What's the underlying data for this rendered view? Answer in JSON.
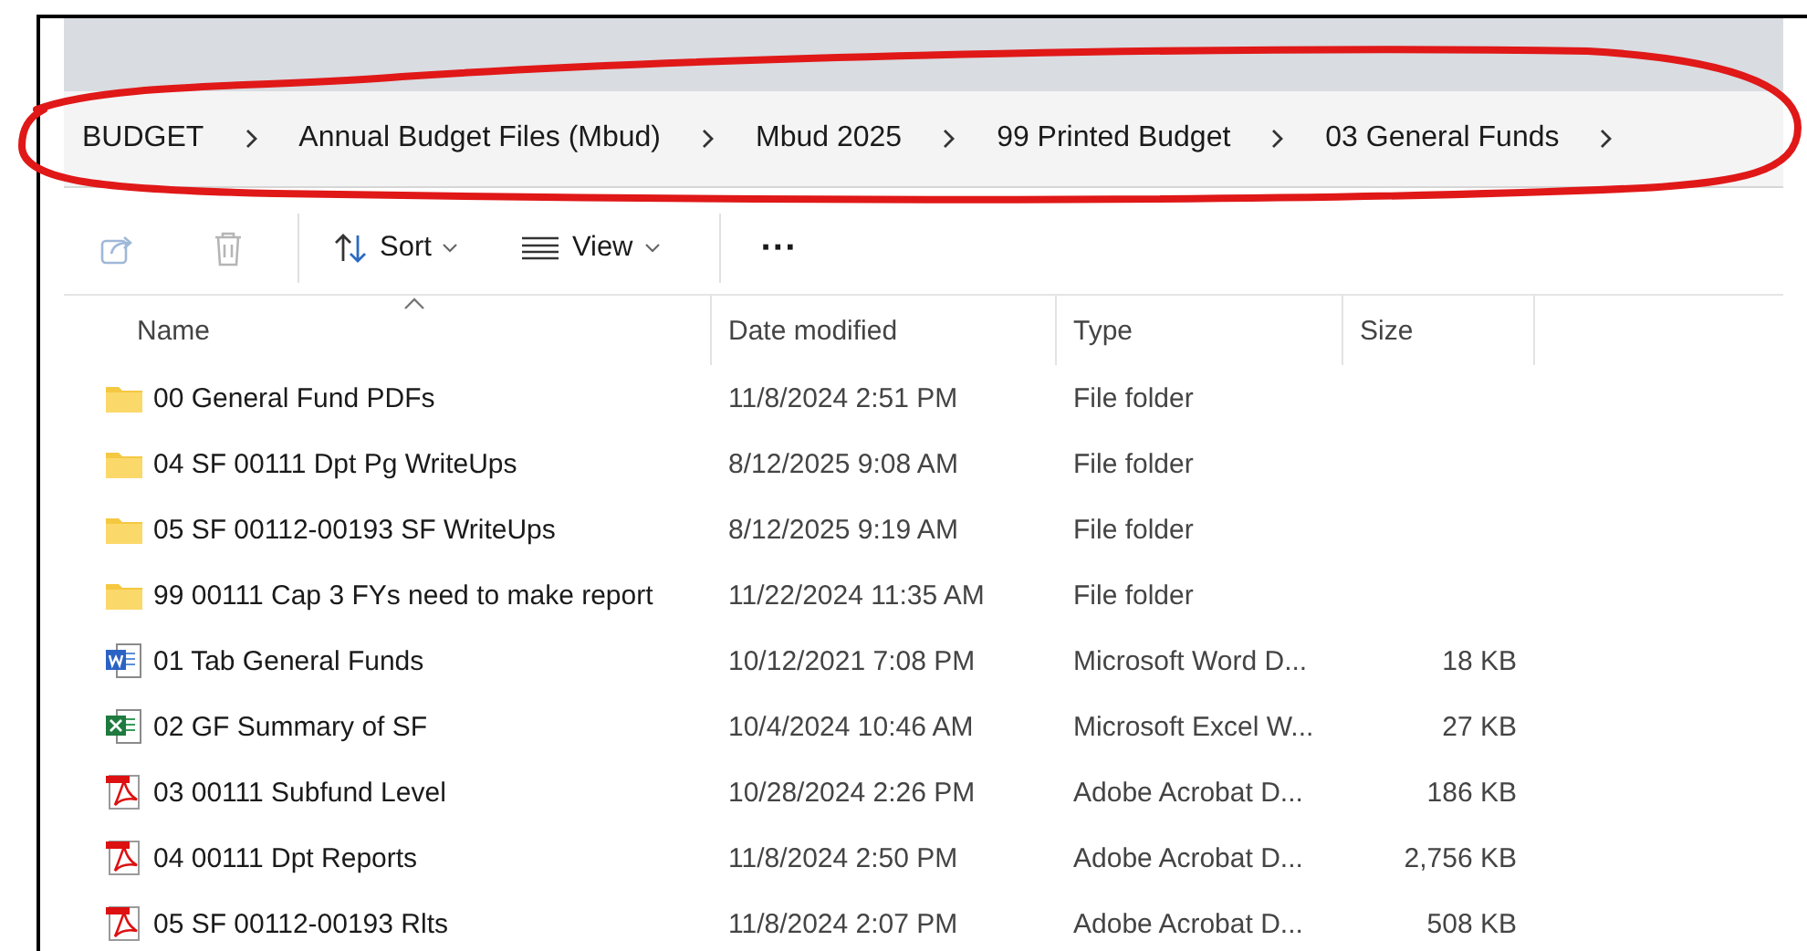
{
  "annotation": {
    "kind": "ellipse"
  },
  "breadcrumb": [
    {
      "label": "BUDGET"
    },
    {
      "label": "Annual Budget Files (Mbud)"
    },
    {
      "label": "Mbud 2025"
    },
    {
      "label": "99 Printed Budget"
    },
    {
      "label": "03 General Funds"
    }
  ],
  "toolbar": [
    {
      "kind": "share",
      "disabled": true
    },
    {
      "kind": "delete",
      "disabled": true
    },
    {
      "kind": "sort",
      "label": "Sort",
      "disabled": false
    },
    {
      "kind": "view",
      "label": "View",
      "disabled": false
    },
    {
      "kind": "more",
      "label": "···",
      "disabled": false
    }
  ],
  "table": {
    "columns": [
      "Name",
      "Date modified",
      "Type",
      "Size"
    ],
    "rows": [
      {
        "kind": "folder",
        "name": "00 General Fund PDFs",
        "date": "11/8/2024 2:51 PM",
        "type": "File folder"
      },
      {
        "kind": "folder",
        "name": "04 SF 00111 Dpt Pg WriteUps",
        "date": "8/12/2025 9:08 AM",
        "type": "File folder"
      },
      {
        "kind": "folder",
        "name": "05 SF 00112-00193 SF WriteUps",
        "date": "8/12/2025 9:19 AM",
        "type": "File folder"
      },
      {
        "kind": "folder",
        "name": "99 00111 Cap 3 FYs need to make report",
        "date": "11/22/2024 11:35 AM",
        "type": "File folder"
      },
      {
        "kind": "word",
        "name": "01 Tab General Funds",
        "date": "10/12/2021 7:08 PM",
        "type": "Microsoft Word D...",
        "size": "18 KB"
      },
      {
        "kind": "excel",
        "name": "02 GF Summary of SF",
        "date": "10/4/2024 10:46 AM",
        "type": "Microsoft Excel W...",
        "size": "27 KB"
      },
      {
        "kind": "pdf",
        "name": "03 00111 Subfund Level",
        "date": "10/28/2024 2:26 PM",
        "type": "Adobe Acrobat D...",
        "size": "186 KB"
      },
      {
        "kind": "pdf",
        "name": "04 00111 Dpt Reports",
        "date": "11/8/2024 2:50 PM",
        "type": "Adobe Acrobat D...",
        "size": "2,756 KB"
      },
      {
        "kind": "pdf",
        "name": "05 SF 00112-00193 Rlts",
        "date": "11/8/2024 2:07 PM",
        "type": "Adobe Acrobat D...",
        "size": "508 KB"
      }
    ]
  }
}
